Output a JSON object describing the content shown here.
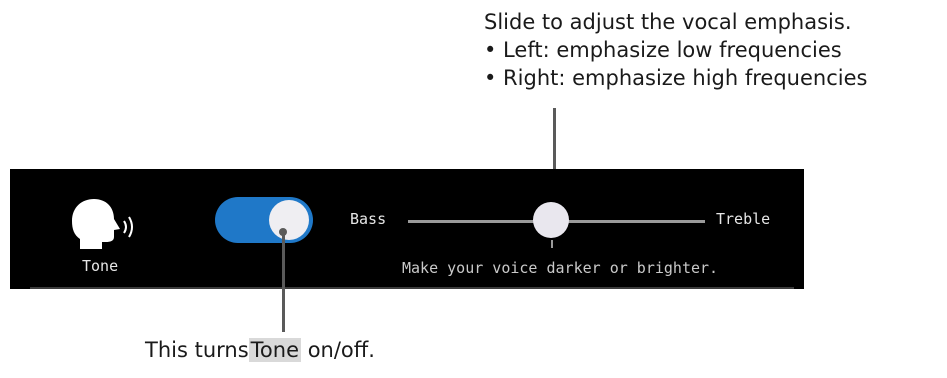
{
  "top_callout": {
    "heading": "Slide to adjust the vocal emphasis.",
    "bullets": [
      "• Left: emphasize low frequencies",
      "• Right: emphasize high frequencies"
    ]
  },
  "panel": {
    "setting_label": "Tone",
    "setting_icon": "speaking-head-icon",
    "toggle": {
      "state": "on",
      "accent": "#1f78c8"
    },
    "slider": {
      "min_label": "Bass",
      "max_label": "Treble",
      "value_fraction": 0.48
    },
    "hint": "Make your voice darker or brighter."
  },
  "bottom_callout": {
    "prefix": "This turns",
    "highlight": "Tone",
    "suffix": "on/off."
  }
}
